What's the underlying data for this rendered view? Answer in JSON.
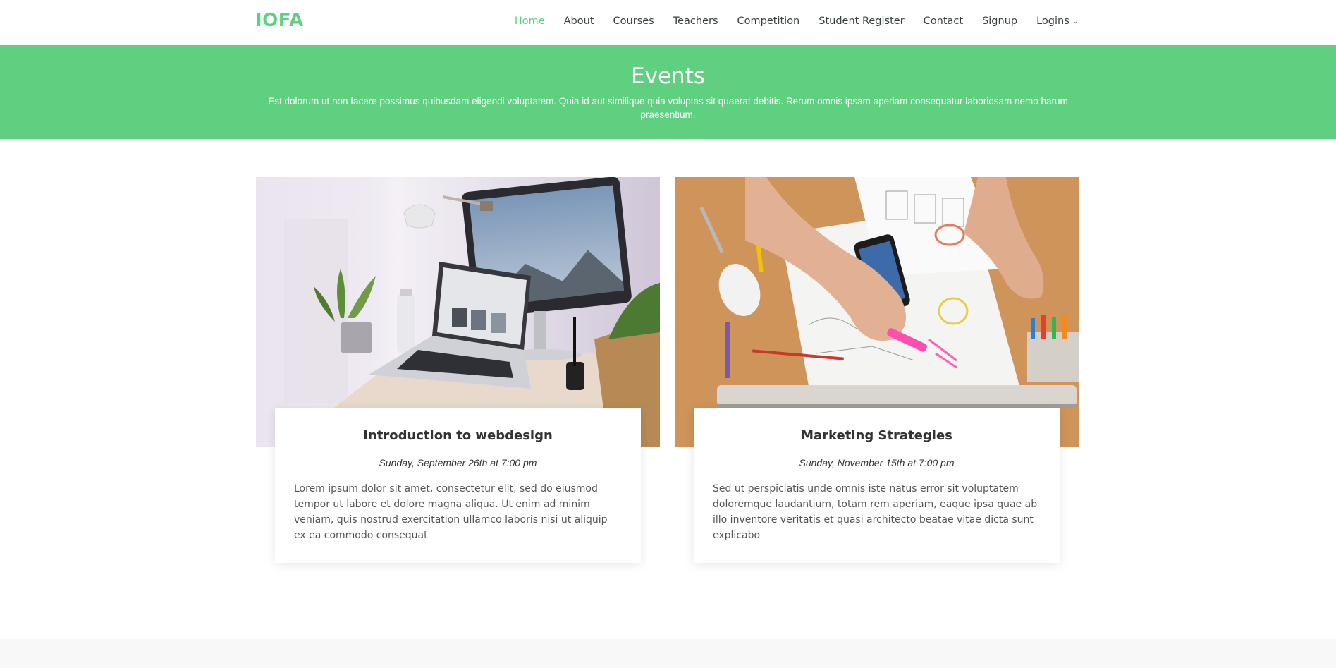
{
  "brand": {
    "logo": "IOFA",
    "accent": "#5fcf80"
  },
  "nav": {
    "items": [
      {
        "label": "Home",
        "active": true
      },
      {
        "label": "About",
        "active": false
      },
      {
        "label": "Courses",
        "active": false
      },
      {
        "label": "Teachers",
        "active": false
      },
      {
        "label": "Competition",
        "active": false
      },
      {
        "label": "Student Register",
        "active": false
      },
      {
        "label": "Contact",
        "active": false
      },
      {
        "label": "Signup",
        "active": false
      }
    ],
    "dropdown": {
      "label": "Logins",
      "icon": "chevron-down-icon"
    }
  },
  "hero": {
    "title": "Events",
    "subtitle": "Est dolorum ut non facere possimus quibusdam eligendi voluptatem. Quia id aut similique quia voluptas sit quaerat debitis. Rerum omnis ipsam aperiam consequatur laboriosam nemo harum praesentium."
  },
  "events": [
    {
      "title": "Introduction to webdesign",
      "date": "Sunday, September 26th at 7:00 pm",
      "text": "Lorem ipsum dolor sit amet, consectetur elit, sed do eiusmod tempor ut labore et dolore magna aliqua. Ut enim ad minim veniam, quis nostrud exercitation ullamco laboris nisi ut aliquip ex ea commodo consequat",
      "image_alt": "desk with laptop and monitor"
    },
    {
      "title": "Marketing Strategies",
      "date": "Sunday, November 15th at 7:00 pm",
      "text": "Sed ut perspiciatis unde omnis iste natus error sit voluptatem doloremque laudantium, totam rem aperiam, eaque ipsa quae ab illo inventore veritatis et quasi architecto beatae vitae dicta sunt explicabo",
      "image_alt": "hands sketching on paper on wooden desk"
    }
  ]
}
